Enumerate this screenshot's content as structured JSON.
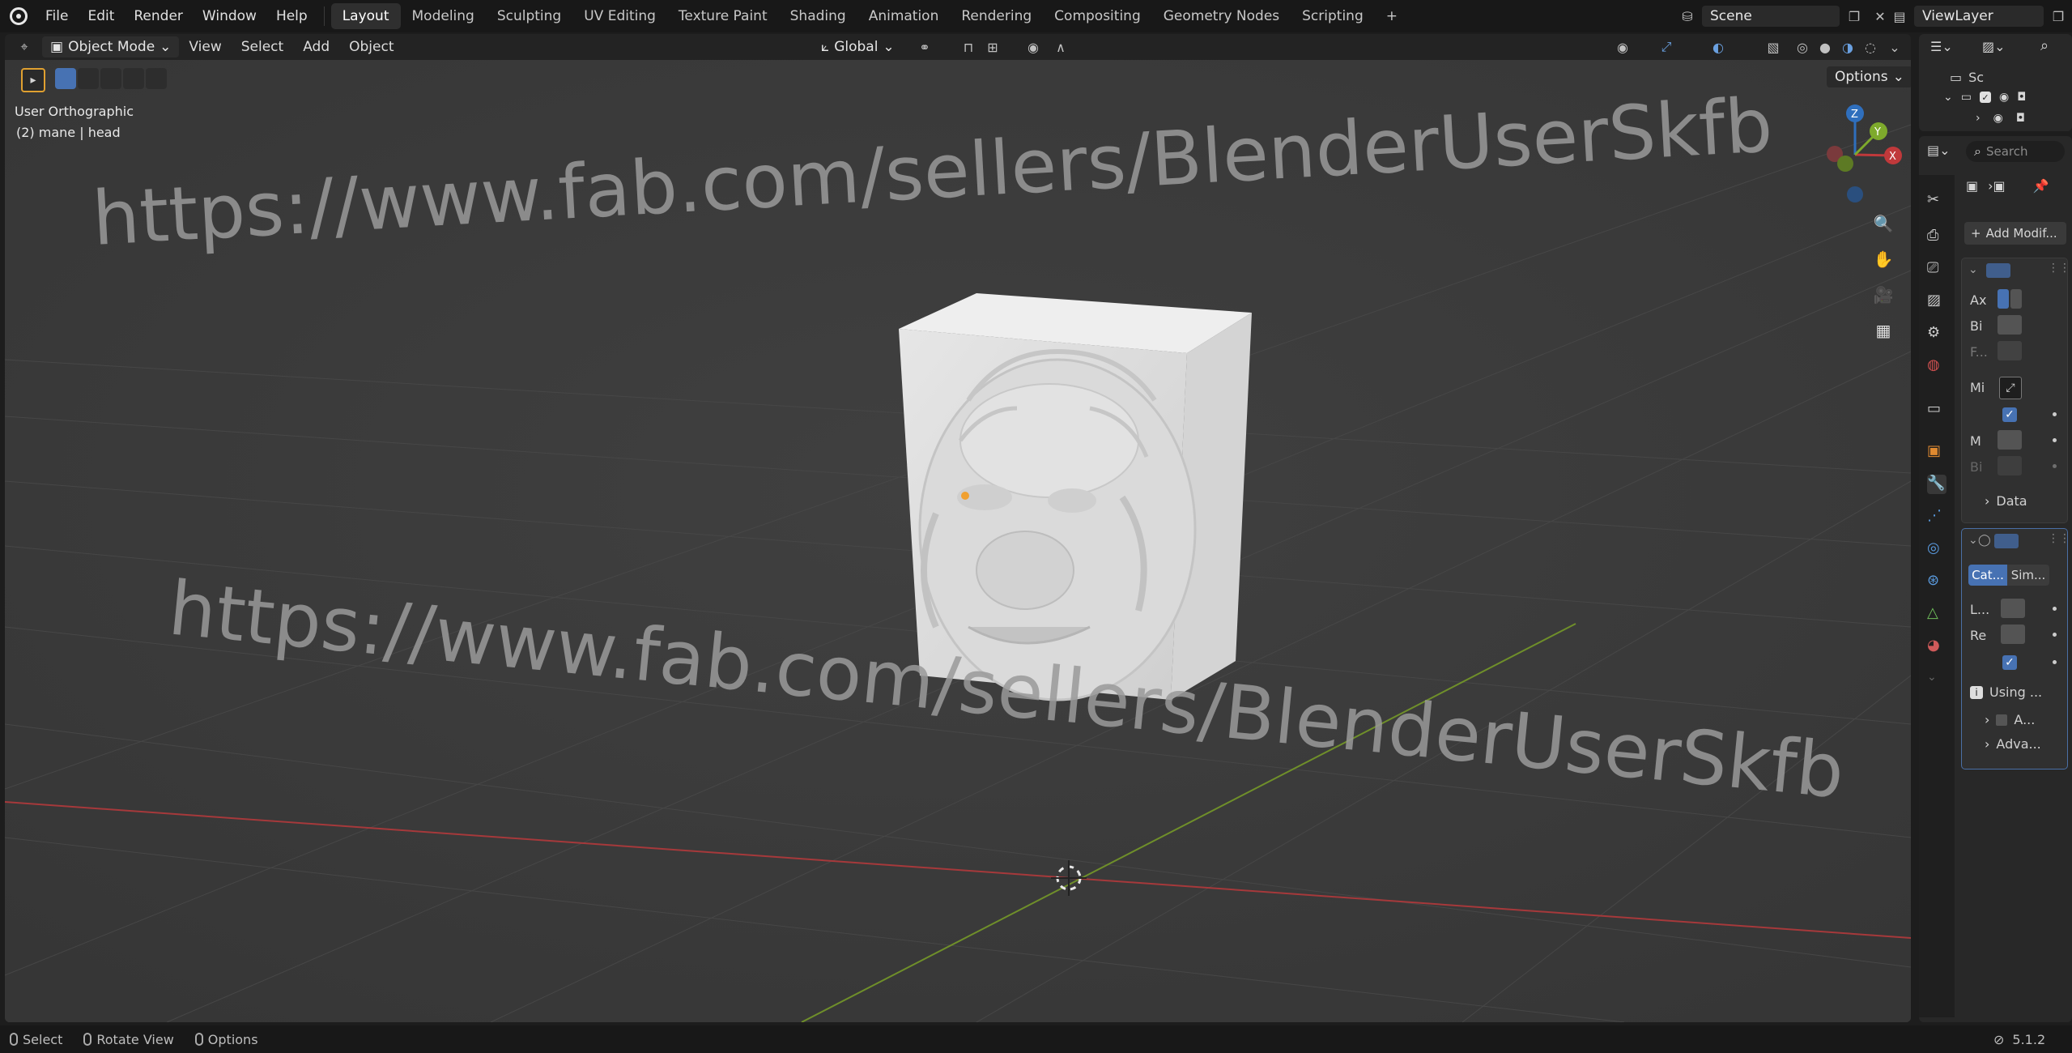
{
  "topbar": {
    "menus": [
      "File",
      "Edit",
      "Render",
      "Window",
      "Help"
    ],
    "workspaces": [
      "Layout",
      "Modeling",
      "Sculpting",
      "UV Editing",
      "Texture Paint",
      "Shading",
      "Animation",
      "Rendering",
      "Compositing",
      "Geometry Nodes",
      "Scripting"
    ],
    "active_workspace": "Layout",
    "add_ws": "+",
    "scene_name": "Scene",
    "view_layer": "ViewLayer"
  },
  "viewport_header": {
    "mode": "Object Mode",
    "menus": [
      "View",
      "Select",
      "Add",
      "Object"
    ],
    "transform_orientation": "Global",
    "options_label": "Options"
  },
  "viewport": {
    "view_name": "User Orthographic",
    "object_info": "(2) mane | head",
    "watermark_1": "https://www.fab.com/sellers/BlenderUserSkfb",
    "watermark_2": "https://www.fab.com/sellers/BlenderUserSkfb"
  },
  "outliner": {
    "row_scene": "Sc"
  },
  "properties": {
    "search_placeholder": "Search",
    "add_modifier": "Add Modif...",
    "mod1_rows": [
      "Ax",
      "Bi",
      "F...",
      "Mi",
      "M",
      "Bi"
    ],
    "data_label": "Data",
    "mod2_tab_a": "Cat...",
    "mod2_tab_b": "Sim...",
    "mod2_rows": [
      "L...",
      "Re"
    ],
    "using_label": "Using ...",
    "sub_a": "A...",
    "sub_adv": "Adva..."
  },
  "statusbar": {
    "select": "Select",
    "rotate": "Rotate View",
    "options": "Options",
    "version": "5.1.2"
  },
  "colors": {
    "accent": "#4772b3",
    "x_axis": "#c0393b",
    "y_axis": "#7eaa2c",
    "z_axis": "#2f6fbd",
    "viewport_bg": "#3a3a3a"
  }
}
